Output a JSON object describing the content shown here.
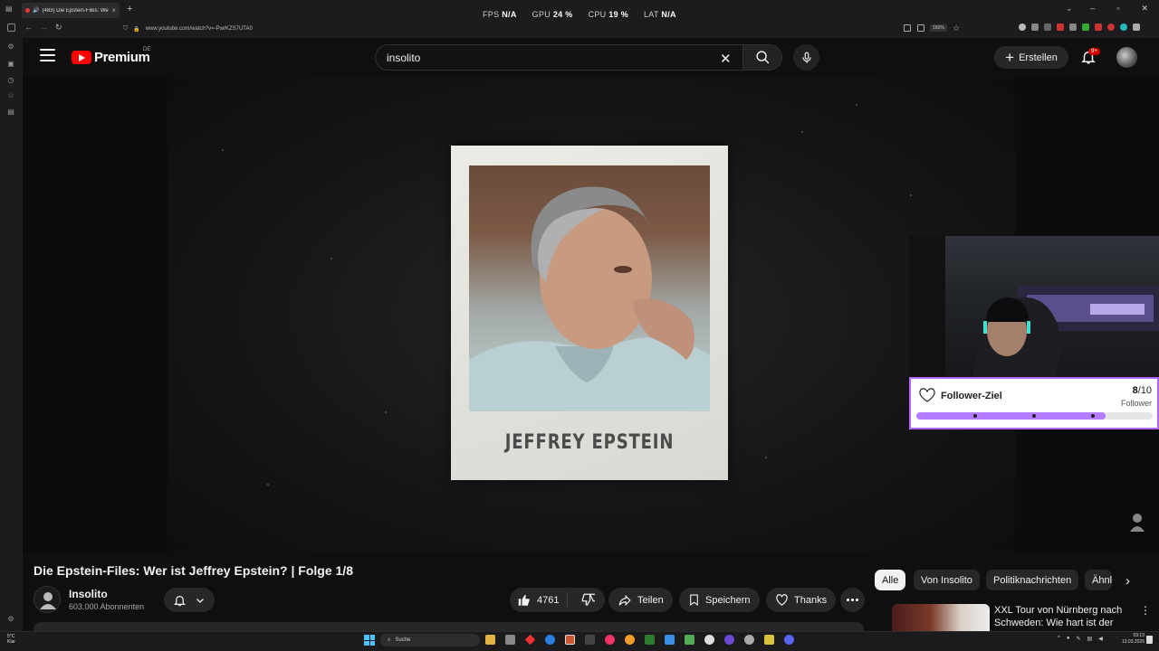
{
  "browser": {
    "tab_title": "(483) Die Epstein-Files: Wer",
    "url": "www.youtube.com/watch?v=-PwrKZS7UTA0",
    "zoom": "150%",
    "perf": {
      "fps_label": "FPS",
      "fps": "N/A",
      "gpu_label": "GPU",
      "gpu": "24 %",
      "cpu_label": "CPU",
      "cpu": "19 %",
      "lat_label": "LAT",
      "lat": "N/A"
    }
  },
  "masthead": {
    "logo_word": "Premium",
    "country": "DE",
    "search_value": "insolito",
    "create_label": "Erstellen",
    "notifications_badge": "9+"
  },
  "video": {
    "caption": "JEFFREY EPSTEIN",
    "title": "Die Epstein-Files: Wer ist Jeffrey Epstein? | Folge 1/8"
  },
  "overlay": {
    "goal_title": "Follower-Ziel",
    "current": "8",
    "target": "/10",
    "unit": "Follower",
    "progress": 0.8
  },
  "channel": {
    "name": "Insolito",
    "subscribers": "603.000 Abonnenten"
  },
  "actions": {
    "likes": "4761",
    "share": "Teilen",
    "save": "Speichern",
    "thanks": "Thanks"
  },
  "chips": [
    "Alle",
    "Von Insolito",
    "Politiknachrichten",
    "Ähnl"
  ],
  "recommended": {
    "title": "XXL Tour von Nürnberg nach Schweden: Wie hart ist der Jo..."
  },
  "taskbar": {
    "weather_temp": "5°C",
    "weather_desc": "Klar",
    "search_label": "Suche",
    "time": "03:13",
    "date": "13.03.2026"
  }
}
